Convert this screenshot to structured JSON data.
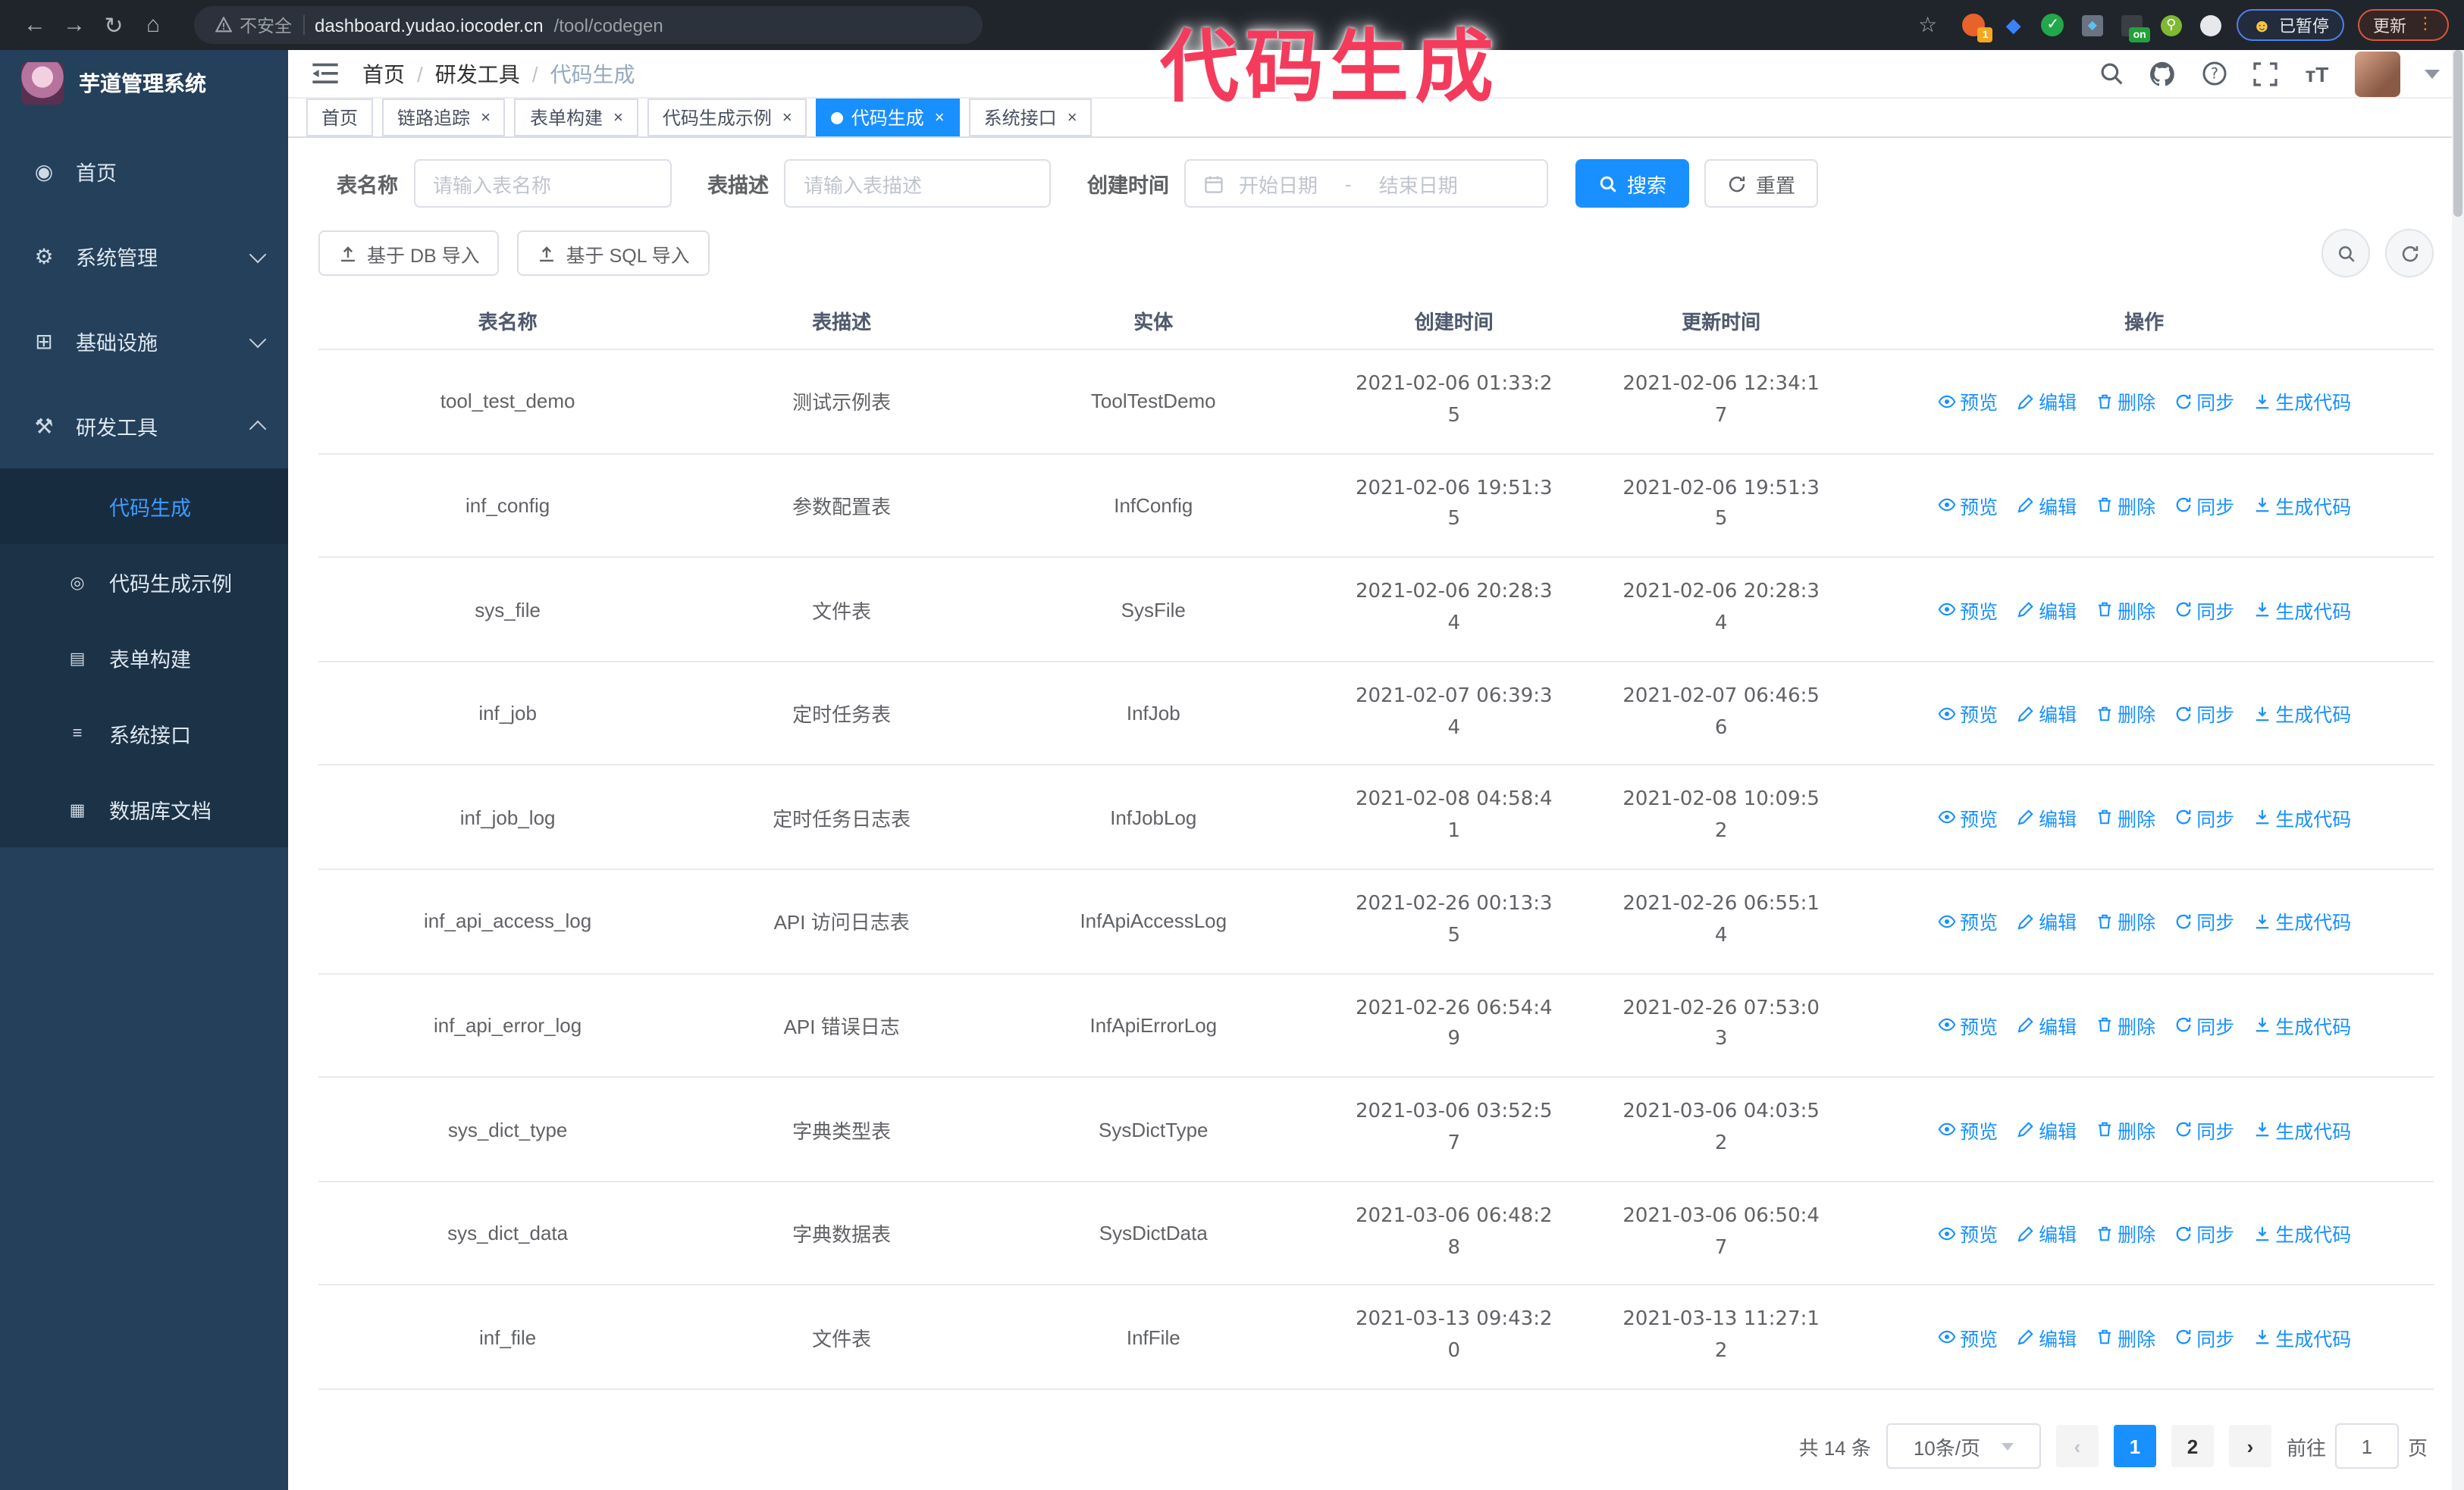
{
  "browser": {
    "back": "←",
    "forward": "→",
    "reload": "↻",
    "home": "⌂",
    "security_label": "不安全",
    "url_host": "dashboard.yudao.iocoder.cn",
    "url_path": "/tool/codegen",
    "bookmark_star": "☆",
    "extension_badge": "1",
    "extension_on_badge": "on",
    "paused_label": "已暂停",
    "update_label": "更新",
    "menu_dots": "⋮"
  },
  "annotation": {
    "text": "代码生成",
    "color": "#f43b5c"
  },
  "sidebar": {
    "title": "芋道管理系统",
    "menu": [
      {
        "label": "首页",
        "icon": "dashboard-icon",
        "glyph": "◉",
        "chevron": ""
      },
      {
        "label": "系统管理",
        "icon": "gear-icon",
        "glyph": "⚙",
        "chevron": "down"
      },
      {
        "label": "基础设施",
        "icon": "infrastructure-icon",
        "glyph": "⊞",
        "chevron": "down"
      },
      {
        "label": "研发工具",
        "icon": "dev-tools-icon",
        "glyph": "⚒",
        "chevron": "up",
        "expanded": true,
        "children": [
          {
            "label": "代码生成",
            "icon": "code-icon",
            "glyph": "</>",
            "active": true
          },
          {
            "label": "代码生成示例",
            "icon": "code-example-icon",
            "glyph": "◎",
            "active": false
          },
          {
            "label": "表单构建",
            "icon": "form-builder-icon",
            "glyph": "▤",
            "active": false
          },
          {
            "label": "系统接口",
            "icon": "api-icon",
            "glyph": "≡",
            "active": false
          },
          {
            "label": "数据库文档",
            "icon": "database-doc-icon",
            "glyph": "▦",
            "active": false
          }
        ]
      }
    ]
  },
  "header": {
    "breadcrumb": [
      "首页",
      "研发工具",
      "代码生成"
    ]
  },
  "tabs": [
    {
      "label": "首页",
      "closable": false,
      "active": false
    },
    {
      "label": "链路追踪",
      "closable": true,
      "active": false
    },
    {
      "label": "表单构建",
      "closable": true,
      "active": false
    },
    {
      "label": "代码生成示例",
      "closable": true,
      "active": false
    },
    {
      "label": "代码生成",
      "closable": true,
      "active": true
    },
    {
      "label": "系统接口",
      "closable": true,
      "active": false
    }
  ],
  "filters": {
    "table_name_label": "表名称",
    "table_name_placeholder": "请输入表名称",
    "table_desc_label": "表描述",
    "table_desc_placeholder": "请输入表描述",
    "create_time_label": "创建时间",
    "start_placeholder": "开始日期",
    "range_separator": "-",
    "end_placeholder": "结束日期",
    "search_label": "搜索",
    "reset_label": "重置"
  },
  "toolbar": {
    "import_db_label": "基于 DB 导入",
    "import_sql_label": "基于 SQL 导入"
  },
  "table": {
    "columns": [
      "表名称",
      "表描述",
      "实体",
      "创建时间",
      "更新时间",
      "操作"
    ],
    "rows": [
      {
        "name": "tool_test_demo",
        "desc": "测试示例表",
        "entity": "ToolTestDemo",
        "created": "2021-02-06 01:33:25",
        "updated": "2021-02-06 12:34:17"
      },
      {
        "name": "inf_config",
        "desc": "参数配置表",
        "entity": "InfConfig",
        "created": "2021-02-06 19:51:35",
        "updated": "2021-02-06 19:51:35"
      },
      {
        "name": "sys_file",
        "desc": "文件表",
        "entity": "SysFile",
        "created": "2021-02-06 20:28:34",
        "updated": "2021-02-06 20:28:34"
      },
      {
        "name": "inf_job",
        "desc": "定时任务表",
        "entity": "InfJob",
        "created": "2021-02-07 06:39:34",
        "updated": "2021-02-07 06:46:56"
      },
      {
        "name": "inf_job_log",
        "desc": "定时任务日志表",
        "entity": "InfJobLog",
        "created": "2021-02-08 04:58:41",
        "updated": "2021-02-08 10:09:52"
      },
      {
        "name": "inf_api_access_log",
        "desc": "API 访问日志表",
        "entity": "InfApiAccessLog",
        "created": "2021-02-26 00:13:35",
        "updated": "2021-02-26 06:55:14"
      },
      {
        "name": "inf_api_error_log",
        "desc": "API 错误日志",
        "entity": "InfApiErrorLog",
        "created": "2021-02-26 06:54:49",
        "updated": "2021-02-26 07:53:03"
      },
      {
        "name": "sys_dict_type",
        "desc": "字典类型表",
        "entity": "SysDictType",
        "created": "2021-03-06 03:52:57",
        "updated": "2021-03-06 04:03:52"
      },
      {
        "name": "sys_dict_data",
        "desc": "字典数据表",
        "entity": "SysDictData",
        "created": "2021-03-06 06:48:28",
        "updated": "2021-03-06 06:50:47"
      },
      {
        "name": "inf_file",
        "desc": "文件表",
        "entity": "InfFile",
        "created": "2021-03-13 09:43:20",
        "updated": "2021-03-13 11:27:12"
      }
    ],
    "row_actions": [
      {
        "label": "预览",
        "icon": "eye-icon"
      },
      {
        "label": "编辑",
        "icon": "edit-icon"
      },
      {
        "label": "删除",
        "icon": "delete-icon"
      },
      {
        "label": "同步",
        "icon": "sync-icon"
      },
      {
        "label": "生成代码",
        "icon": "download-icon"
      }
    ]
  },
  "pagination": {
    "total_label": "共 14 条",
    "page_size": "10条/页",
    "prev": "‹",
    "next": "›",
    "pages": [
      "1",
      "2"
    ],
    "active_page": "1",
    "goto_label": "前往",
    "goto_value": "1",
    "goto_suffix": "页"
  },
  "colors": {
    "accent": "#1890ff",
    "annotation": "#f43b5c"
  }
}
